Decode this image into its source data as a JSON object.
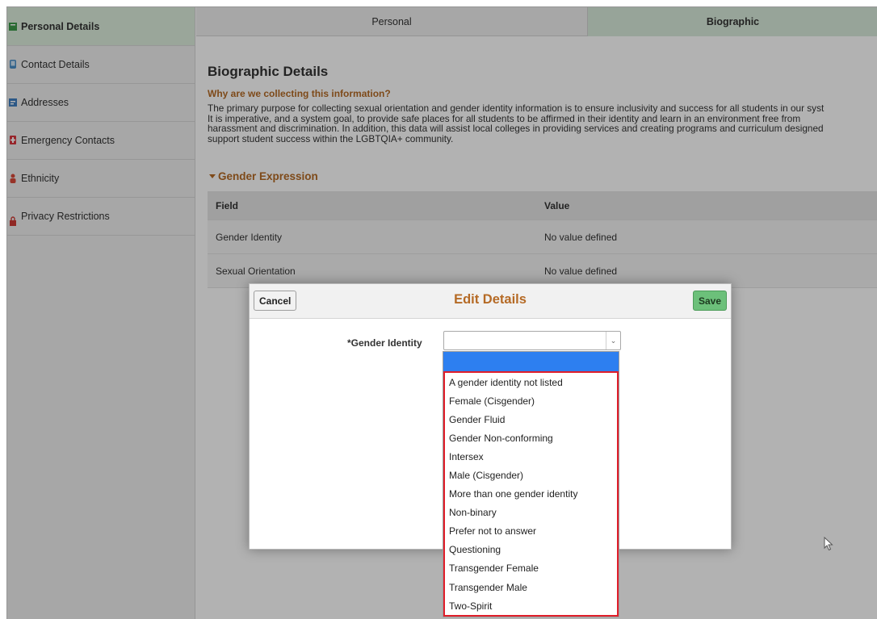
{
  "sidebar": {
    "items": [
      {
        "label": "Personal Details",
        "icon": "green-square-icon"
      },
      {
        "label": "Contact Details",
        "icon": "phone-icon"
      },
      {
        "label": "Addresses",
        "icon": "address-card-icon"
      },
      {
        "label": "Emergency Contacts",
        "icon": "emergency-icon"
      },
      {
        "label": "Ethnicity",
        "icon": "people-icon"
      },
      {
        "label": "Privacy Restrictions",
        "icon": "lock-icon"
      }
    ]
  },
  "tabs": {
    "personal": "Personal",
    "biographic": "Biographic"
  },
  "main": {
    "title": "Biographic Details",
    "why_link": "Why are we collecting this information?",
    "description_lines": [
      "The primary purpose for collecting sexual orientation and gender identity information is to ensure inclusivity and success for all students in our syst",
      "It is imperative, and a system goal, to provide safe places for all students to be affirmed in their identity and learn in an environment free from",
      "harassment and discrimination. In addition, this data will assist local colleges in providing services and creating programs and curriculum designed",
      "support student success within the LGBTQIA+ community."
    ],
    "section_title": "Gender Expression",
    "table": {
      "headers": [
        "Field",
        "Value"
      ],
      "rows": [
        [
          "Gender Identity",
          "No value defined"
        ],
        [
          "Sexual Orientation",
          "No value defined"
        ]
      ]
    }
  },
  "modal": {
    "title": "Edit Details",
    "cancel_label": "Cancel",
    "save_label": "Save",
    "field_label": "*Gender Identity",
    "selected_value": "",
    "options": [
      "A gender identity not listed",
      "Female (Cisgender)",
      "Gender Fluid",
      "Gender Non-conforming",
      "Intersex",
      "Male (Cisgender)",
      "More than one gender identity",
      "Non-binary",
      "Prefer not to answer",
      "Questioning",
      "Transgender Female",
      "Transgender Male",
      "Two-Spirit"
    ]
  },
  "colors": {
    "accent_orange": "#b56a25",
    "active_tab_green": "#d8ebdb",
    "save_green": "#6cc07a",
    "highlight_blue": "#2d7ff0",
    "option_border_red": "#e01e2a"
  }
}
